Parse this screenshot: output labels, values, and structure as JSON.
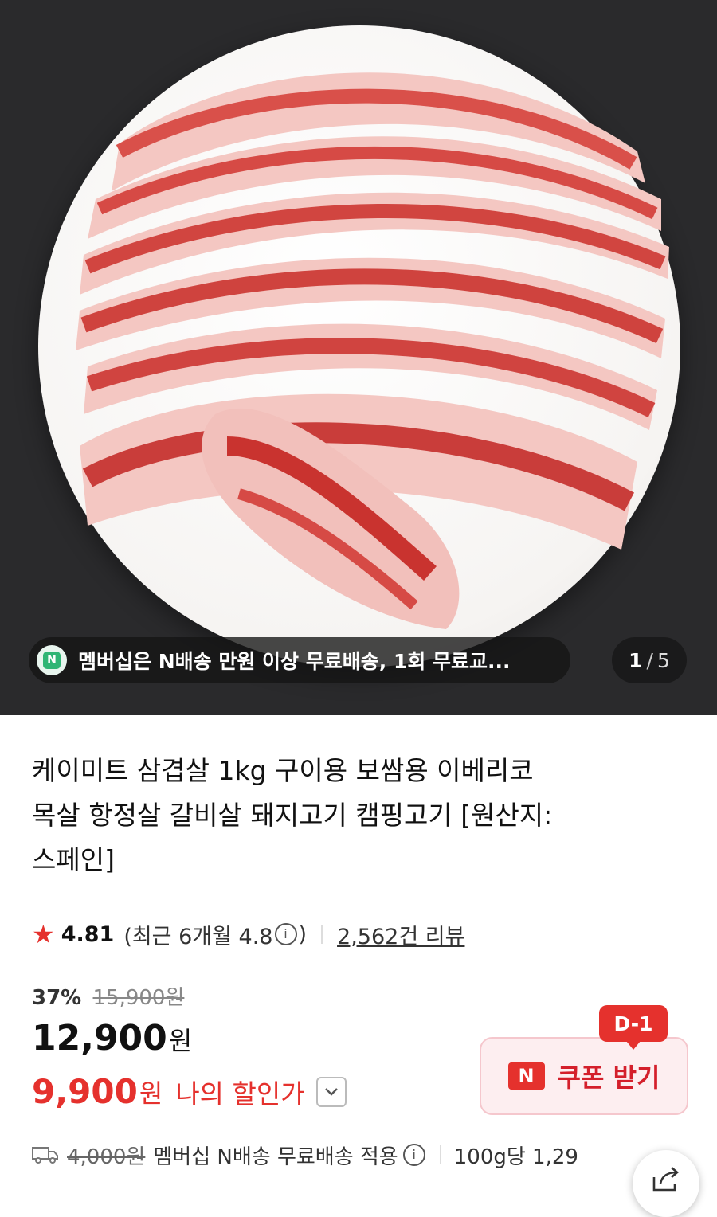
{
  "gallery": {
    "banner_text": "멤버십은 N배송 만원 이상 무료배송, 1회 무료교...",
    "counter_current": "1",
    "counter_sep": "/",
    "counter_total": "5",
    "banner_logo": "N"
  },
  "product": {
    "title_lines": [
      "케이미트 삼겹살 1kg 구이용 보쌈용 이베리코",
      "목살 항정살 갈비살 돼지고기 캠핑고기 [원산지:",
      "스페인]"
    ],
    "rating": "4.81",
    "recent_label": "(최근 6개월 4.8",
    "recent_close": ")",
    "info_glyph": "i",
    "reviews": "2,562건 리뷰",
    "discount_rate": "37%",
    "original_price": "15,900원",
    "price": "12,900",
    "price_unit": "원",
    "my_price": "9,900",
    "my_price_unit": "원",
    "my_price_label": "나의 할인가"
  },
  "coupon": {
    "badge": "D-1",
    "mark": "N",
    "label": "쿠폰 받기"
  },
  "shipping": {
    "original_fee": "4,000원",
    "text": "멤버십 N배송 무료배송 적용",
    "unit_price": "100g당 1,29"
  },
  "icons": {
    "star": "star-icon",
    "info": "info-icon",
    "chevron": "chevron-down-icon",
    "truck": "truck-icon",
    "share": "share-icon"
  },
  "colors": {
    "accent": "#e5312d",
    "coupon_bg": "#fdeef0",
    "hero_bg": "#2a2a2c",
    "membership_green": "#2fb574"
  }
}
